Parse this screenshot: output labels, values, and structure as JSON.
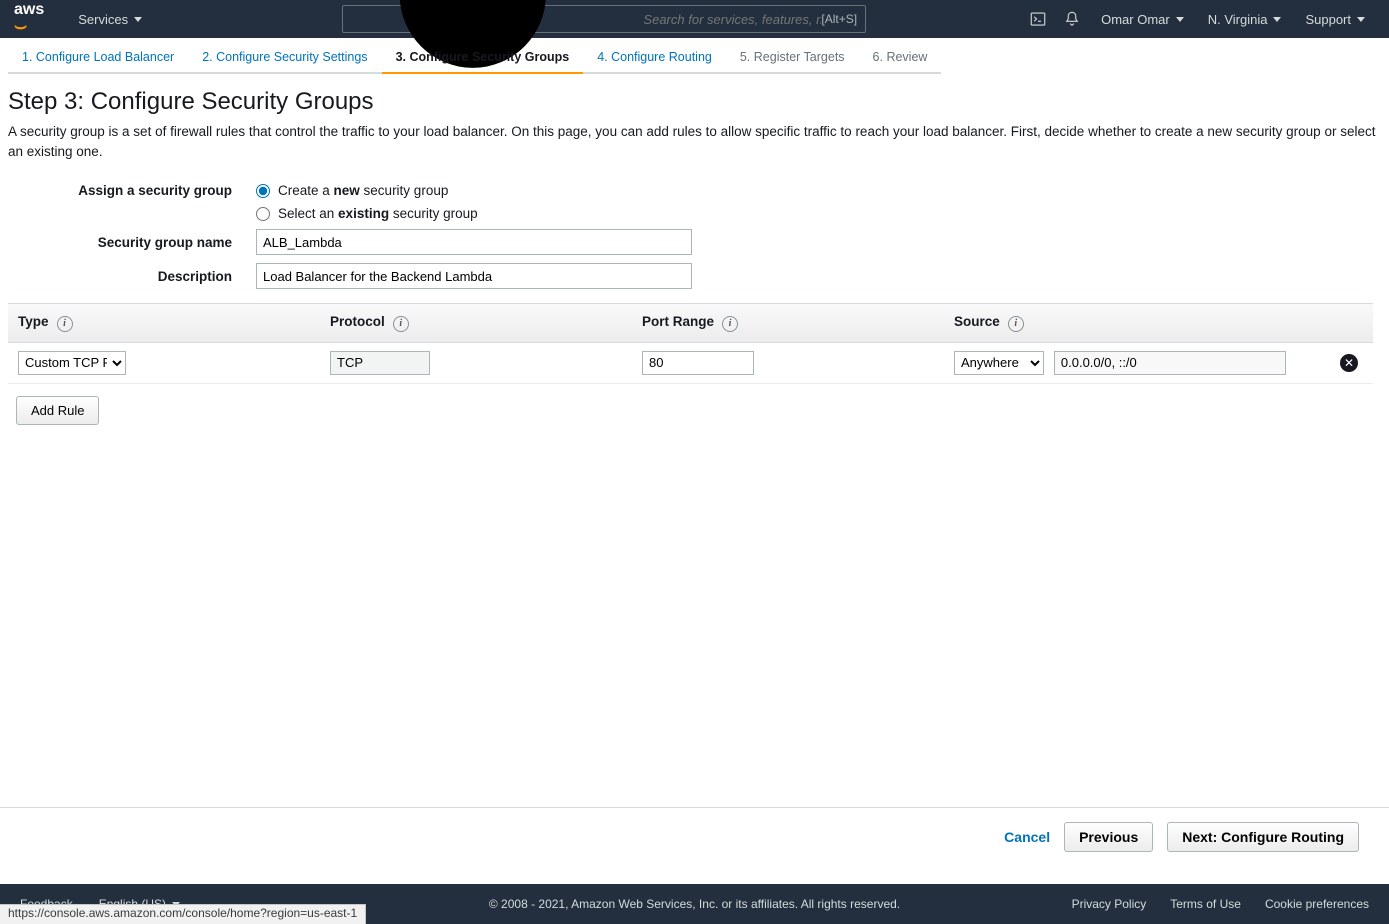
{
  "topnav": {
    "brand": "aws",
    "services_label": "Services",
    "search_placeholder": "Search for services, features, marketplace products, and docs",
    "search_kbd": "[Alt+S]",
    "user_label": "Omar Omar",
    "region_label": "N. Virginia",
    "support_label": "Support"
  },
  "wizard": {
    "steps": [
      {
        "label": "1. Configure Load Balancer",
        "state": "link"
      },
      {
        "label": "2. Configure Security Settings",
        "state": "link"
      },
      {
        "label": "3. Configure Security Groups",
        "state": "active"
      },
      {
        "label": "4. Configure Routing",
        "state": "link"
      },
      {
        "label": "5. Register Targets",
        "state": "disabled"
      },
      {
        "label": "6. Review",
        "state": "disabled"
      }
    ]
  },
  "page": {
    "heading": "Step 3: Configure Security Groups",
    "description": "A security group is a set of firewall rules that control the traffic to your load balancer. On this page, you can add rules to allow specific traffic to reach your load balancer. First, decide whether to create a new security group or select an existing one."
  },
  "form": {
    "assign_label": "Assign a security group",
    "create_option_prefix": "Create a ",
    "create_option_bold": "new",
    "create_option_suffix": " security group",
    "select_option_prefix": "Select an ",
    "select_option_bold": "existing",
    "select_option_suffix": " security group",
    "sg_name_label": "Security group name",
    "sg_name_value": "ALB_Lambda",
    "desc_label": "Description",
    "desc_value": "Load Balancer for the Backend Lambda"
  },
  "table": {
    "headers": {
      "type": "Type",
      "protocol": "Protocol",
      "port": "Port Range",
      "source": "Source"
    },
    "rows": [
      {
        "type_selected": "Custom TCP Rule",
        "type_options": [
          "Custom TCP Rule"
        ],
        "protocol": "TCP",
        "port": "80",
        "source_selected": "Anywhere",
        "source_options": [
          "Anywhere"
        ],
        "source_cidr": "0.0.0.0/0, ::/0"
      }
    ],
    "add_rule_label": "Add Rule"
  },
  "actions": {
    "cancel": "Cancel",
    "previous": "Previous",
    "next": "Next: Configure Routing"
  },
  "footer": {
    "feedback": "Feedback",
    "language": "English (US)",
    "copyright": "© 2008 - 2021, Amazon Web Services, Inc. or its affiliates. All rights reserved.",
    "privacy": "Privacy Policy",
    "terms": "Terms of Use",
    "cookies": "Cookie preferences"
  },
  "status_url": "https://console.aws.amazon.com/console/home?region=us-east-1"
}
